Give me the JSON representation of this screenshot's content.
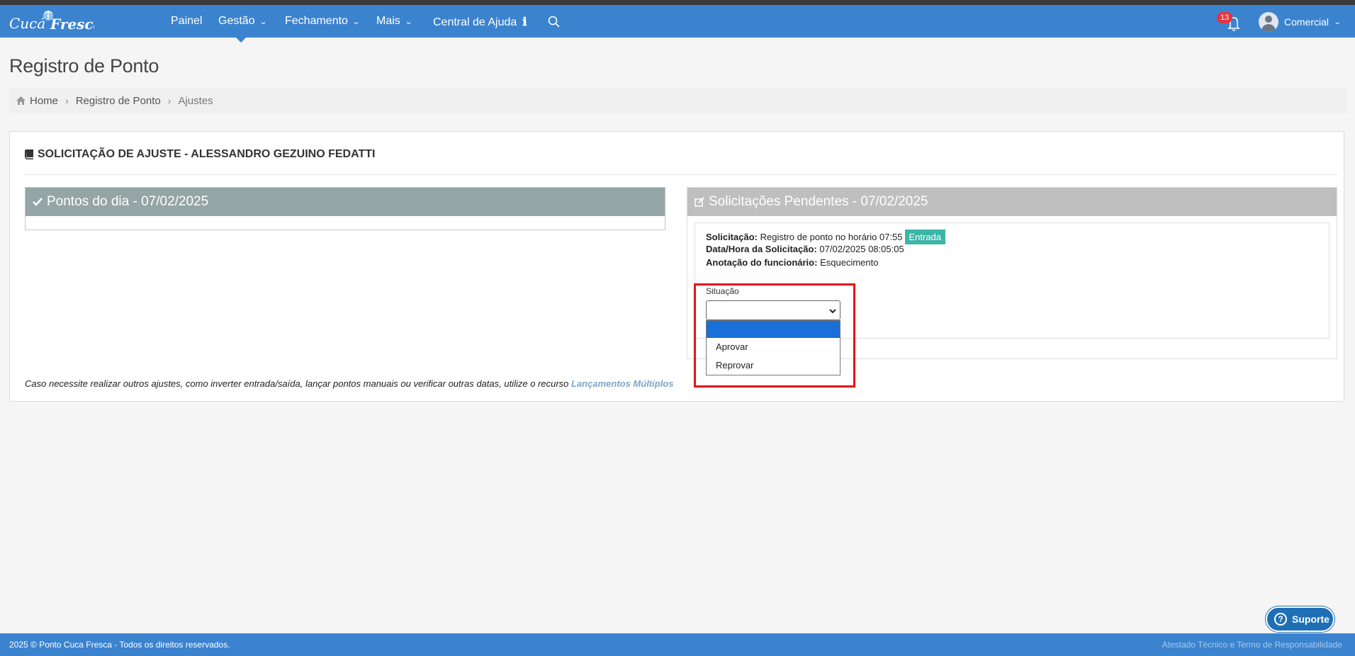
{
  "brand": {
    "logo_text_left": "Cucá",
    "logo_text_right": "Fresca"
  },
  "nav": {
    "items": [
      {
        "label": "Painel"
      },
      {
        "label": "Gestão"
      },
      {
        "label": "Fechamento"
      },
      {
        "label": "Mais"
      },
      {
        "label": "Central de Ajuda"
      }
    ],
    "notifications_count": "13",
    "user_name": "Comercial"
  },
  "page": {
    "title": "Registro de Ponto",
    "breadcrumb": [
      "Home",
      "Registro de Ponto",
      "Ajustes"
    ]
  },
  "card": {
    "title": "SOLICITAÇÃO DE AJUSTE - ALESSANDRO GEZUINO FEDATTI",
    "left_panel": {
      "title": "Pontos do dia - 07/02/2025"
    },
    "right_panel": {
      "title": "Solicitações Pendentes - 07/02/2025",
      "request": {
        "label": "Solicitação:",
        "value": "Registro de ponto no horário 07:55",
        "tag": "Entrada"
      },
      "datetime": {
        "label": "Data/Hora da Solicitação:",
        "value": "07/02/2025 08:05:05"
      },
      "note": {
        "label": "Anotação do funcionário:",
        "value": "Esquecimento"
      },
      "situacao": {
        "label": "Situação",
        "selected": "",
        "options": [
          "",
          "Aprovar",
          "Reprovar"
        ]
      }
    },
    "footnote": {
      "text": "Caso necessite realizar outros ajustes, como inverter entrada/saída, lançar pontos manuais ou verificar outras datas, utilize o recurso",
      "link": "Lançamentos Múltiplos"
    }
  },
  "support_button": "Suporte",
  "footer": {
    "copyright": "2025 © Ponto Cuca Fresca - Todos os direitos reservados.",
    "right_link": "Atestado Técnico e Termo de Responsabilidade"
  },
  "colors": {
    "navbar": "#3b83cf",
    "left_panel_header": "#95a5a6",
    "right_panel_header": "#bfbfbf",
    "tag": "#3bb5a8",
    "selected_option": "#1a6fd9",
    "highlight": "#e3151a"
  }
}
